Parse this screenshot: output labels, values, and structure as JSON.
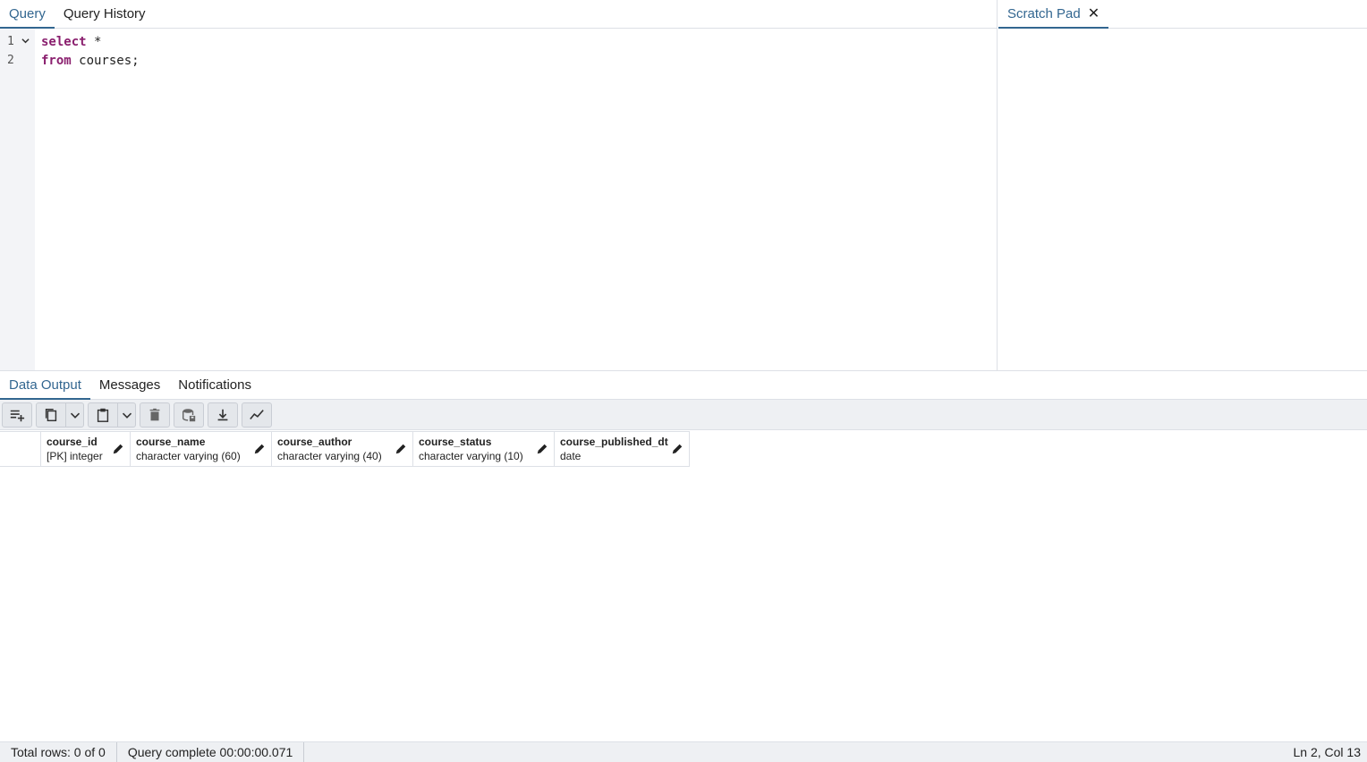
{
  "editor_tabs": [
    {
      "label": "Query"
    },
    {
      "label": "Query History"
    }
  ],
  "scratch": {
    "label": "Scratch Pad",
    "close": "✕"
  },
  "code": {
    "lines": [
      {
        "num": "1",
        "kw": "select",
        "rest": " *"
      },
      {
        "num": "2",
        "kw": "from",
        "rest": " courses;"
      }
    ]
  },
  "output_tabs": [
    {
      "label": "Data Output"
    },
    {
      "label": "Messages"
    },
    {
      "label": "Notifications"
    }
  ],
  "toolbar": {
    "icons": [
      "add-row-icon",
      "copy-icon",
      "chevron-down-icon",
      "paste-icon",
      "chevron-down-icon",
      "delete-icon",
      "save-data-icon",
      "download-icon",
      "graph-icon"
    ]
  },
  "columns": [
    {
      "name": "course_id",
      "type": "[PK] integer"
    },
    {
      "name": "course_name",
      "type": "character varying (60)"
    },
    {
      "name": "course_author",
      "type": "character varying (40)"
    },
    {
      "name": "course_status",
      "type": "character varying (10)"
    },
    {
      "name": "course_published_dt",
      "type": "date"
    }
  ],
  "status": {
    "rows": "Total rows: 0 of 0",
    "query": "Query complete 00:00:00.071",
    "cursor": "Ln 2, Col 13"
  },
  "colors": {
    "accent": "#326690",
    "keyword": "#8a1f6e"
  }
}
